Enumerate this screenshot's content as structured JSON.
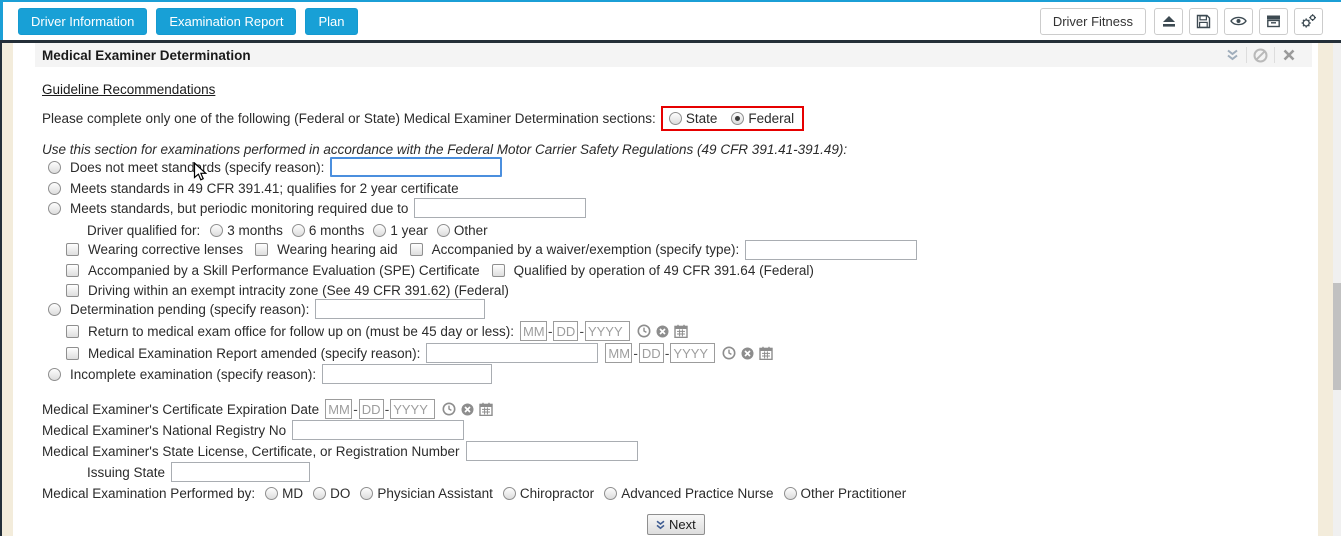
{
  "toolbar": {
    "tabs": [
      {
        "label": "Driver Information"
      },
      {
        "label": "Examination Report"
      },
      {
        "label": "Plan"
      }
    ],
    "driver_fitness_label": "Driver Fitness",
    "icon_buttons": [
      "eject-icon",
      "save-icon",
      "eye-icon",
      "archive-icon",
      "gears-icon"
    ]
  },
  "panel": {
    "title": "Medical Examiner Determination",
    "header_icons": [
      "chevron-double-down-icon",
      "ban-icon",
      "close-icon"
    ]
  },
  "links": {
    "guideline": "Guideline Recommendations"
  },
  "intro": {
    "text": "Please complete only one of the following (Federal or State) Medical Examiner Determination sections:",
    "options": [
      {
        "label": "State",
        "selected": false
      },
      {
        "label": "Federal",
        "selected": true
      }
    ]
  },
  "federal_note": "Use this section for examinations performed in accordance with the Federal Motor Carrier Safety Regulations (49 CFR 391.41-391.49):",
  "determination": {
    "does_not_meet": "Does not meet standards (specify reason):",
    "meets_standards": "Meets standards in 49 CFR 391.41; qualifies for 2 year certificate",
    "periodic_monitoring": "Meets standards, but periodic monitoring required due to",
    "driver_qualified_for": "Driver qualified for:",
    "qualified_options": [
      "3 months",
      "6 months",
      "1 year",
      "Other"
    ],
    "corrective_lenses": "Wearing corrective lenses",
    "hearing_aid": "Wearing hearing aid",
    "waiver": "Accompanied by a waiver/exemption (specify type):",
    "spe_certificate": "Accompanied by a Skill Performance Evaluation (SPE) Certificate",
    "qualified_391_64": "Qualified by operation of 49 CFR 391.64 (Federal)",
    "intracity_zone": "Driving within an exempt intracity zone (See 49 CFR 391.62) (Federal)",
    "pending": "Determination pending (specify reason):",
    "return_followup": "Return to medical exam office for follow up on (must be 45 day or less):",
    "report_amended": "Medical Examination Report amended (specify reason):",
    "incomplete": "Incomplete examination (specify reason):"
  },
  "examiner": {
    "cert_expiration": "Medical Examiner's Certificate Expiration Date",
    "registry_no": "Medical Examiner's National Registry No",
    "state_license": "Medical Examiner's State License, Certificate, or Registration Number",
    "issuing_state": "Issuing State",
    "performed_by": "Medical Examination Performed by:",
    "performed_by_options": [
      "MD",
      "DO",
      "Physician Assistant",
      "Chiropractor",
      "Advanced Practice Nurse",
      "Other Practitioner"
    ]
  },
  "date_placeholders": {
    "mm": "MM",
    "dd": "DD",
    "yyyy": "YYYY"
  },
  "inputs": {
    "all_values_empty": ""
  },
  "next_button": {
    "label": "Next"
  },
  "colors": {
    "accent_blue": "#18a0d6",
    "highlight_red": "#e60000",
    "focus_blue": "#4b8fde",
    "frame_dark": "#242f38",
    "page_strip": "#f3ecdb"
  }
}
